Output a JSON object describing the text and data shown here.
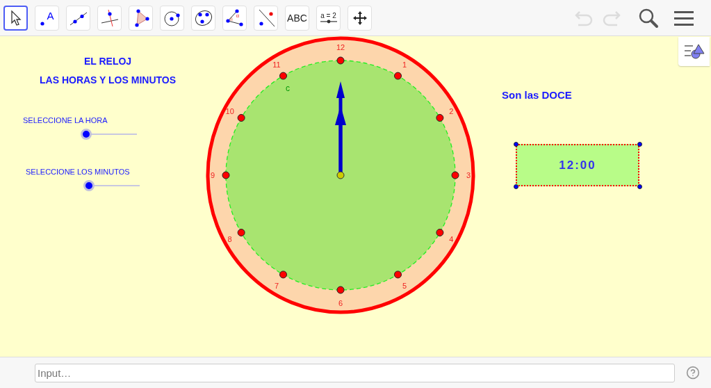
{
  "toolbar": {
    "tools": [
      {
        "kind": "move",
        "selected": true
      },
      {
        "kind": "point",
        "label": "A",
        "selected": false
      },
      {
        "kind": "line",
        "selected": false
      },
      {
        "kind": "perpendicular",
        "selected": false
      },
      {
        "kind": "polygon",
        "selected": false
      },
      {
        "kind": "circle",
        "selected": false
      },
      {
        "kind": "conic",
        "selected": false
      },
      {
        "kind": "angle",
        "label": "α",
        "selected": false
      },
      {
        "kind": "reflect",
        "selected": false
      },
      {
        "kind": "text",
        "label": "ABC",
        "selected": false
      },
      {
        "kind": "slider",
        "label": "a = 2",
        "selected": false
      },
      {
        "kind": "move-view",
        "selected": false
      }
    ],
    "undo": {
      "disabled": true
    },
    "redo": {
      "disabled": true
    }
  },
  "canvas": {
    "title_lines": [
      "EL RELOJ",
      "LAS HORAS Y LOS MINUTOS"
    ],
    "sliders": [
      {
        "label": "SELECCIONE LA HORA",
        "level": 0
      },
      {
        "label": "SELECCIONE LOS MINUTOS",
        "level": 0
      }
    ],
    "clock": {
      "hour_labels": [
        "12",
        "1",
        "2",
        "3",
        "4",
        "5",
        "6",
        "7",
        "8",
        "9",
        "10",
        "11"
      ],
      "circle_label": "c"
    },
    "caption": "Son las DOCE",
    "time_display": "12:00"
  },
  "input_bar": {
    "placeholder": "Input…"
  }
}
